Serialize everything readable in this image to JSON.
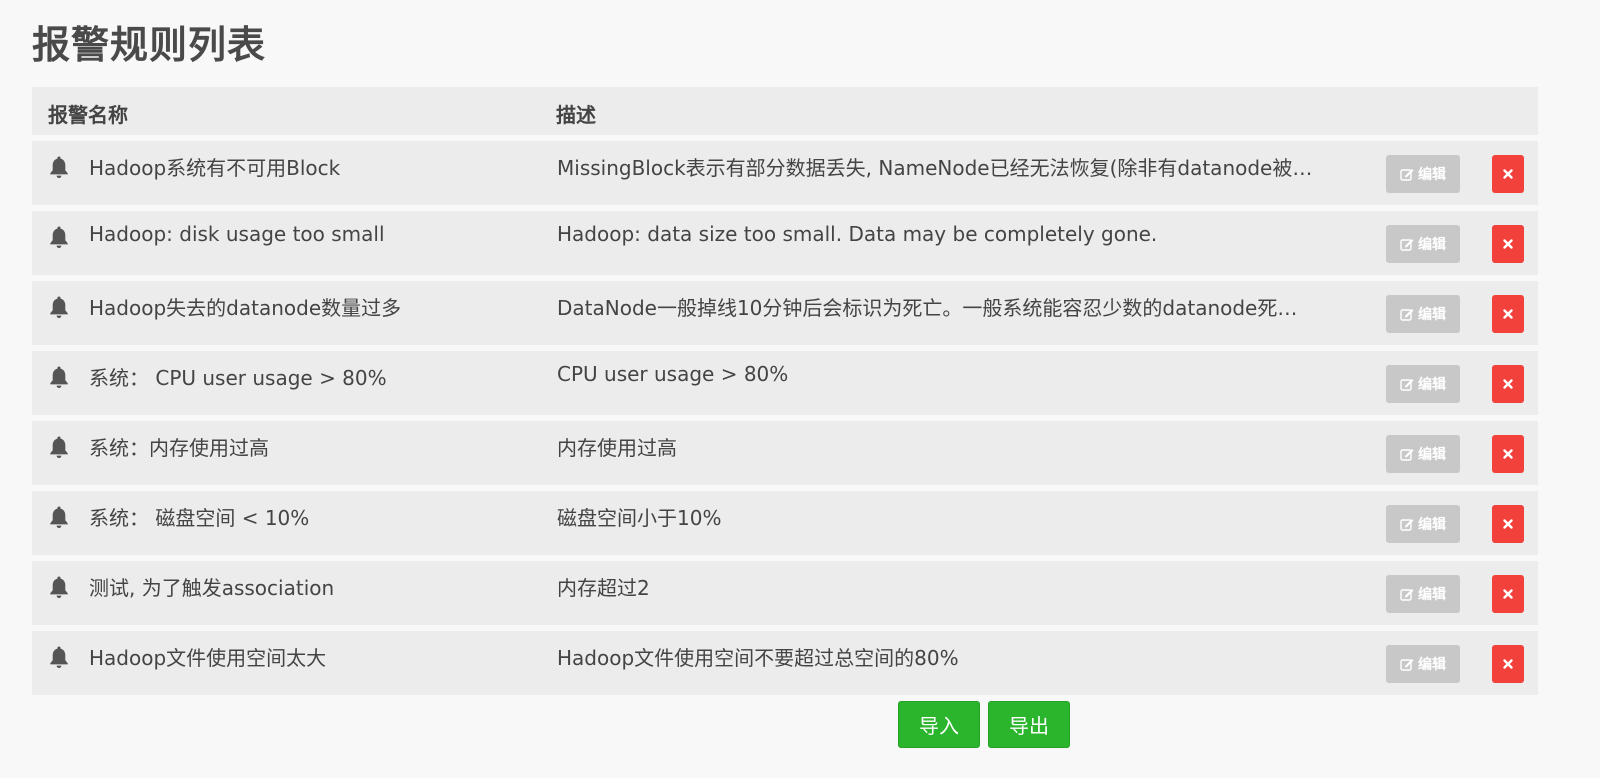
{
  "page": {
    "title": "报警规则列表"
  },
  "table": {
    "headers": {
      "name": "报警名称",
      "description": "描述"
    },
    "edit_label": "编辑",
    "rows": [
      {
        "name": "Hadoop系统有不可用Block",
        "description": "MissingBlock表示有部分数据丢失, NameNode已经无法恢复(除非有datanode被…"
      },
      {
        "name": "Hadoop: disk usage too small",
        "description": "Hadoop: data size too small. Data may be completely gone."
      },
      {
        "name": "Hadoop失去的datanode数量过多",
        "description": "DataNode一般掉线10分钟后会标识为死亡。一般系统能容忍少数的datanode死…"
      },
      {
        "name": "系统： CPU user usage > 80%",
        "description": "CPU user usage > 80%"
      },
      {
        "name": "系统：内存使用过高",
        "description": "内存使用过高"
      },
      {
        "name": "系统： 磁盘空间 < 10%",
        "description": "磁盘空间小于10%"
      },
      {
        "name": "测试, 为了触发association",
        "description": "内存超过2"
      },
      {
        "name": "Hadoop文件使用空间太大",
        "description": "Hadoop文件使用空间不要超过总空间的80%"
      }
    ]
  },
  "actions": {
    "import_label": "导入",
    "export_label": "导出"
  },
  "colors": {
    "edit_button": "#c8c8c8",
    "delete_button": "#f2413b",
    "action_button": "#2ab52c"
  },
  "icons": {
    "row_icon": "bell-icon",
    "edit_icon": "pencil-square-icon",
    "delete_icon": "close-icon"
  }
}
